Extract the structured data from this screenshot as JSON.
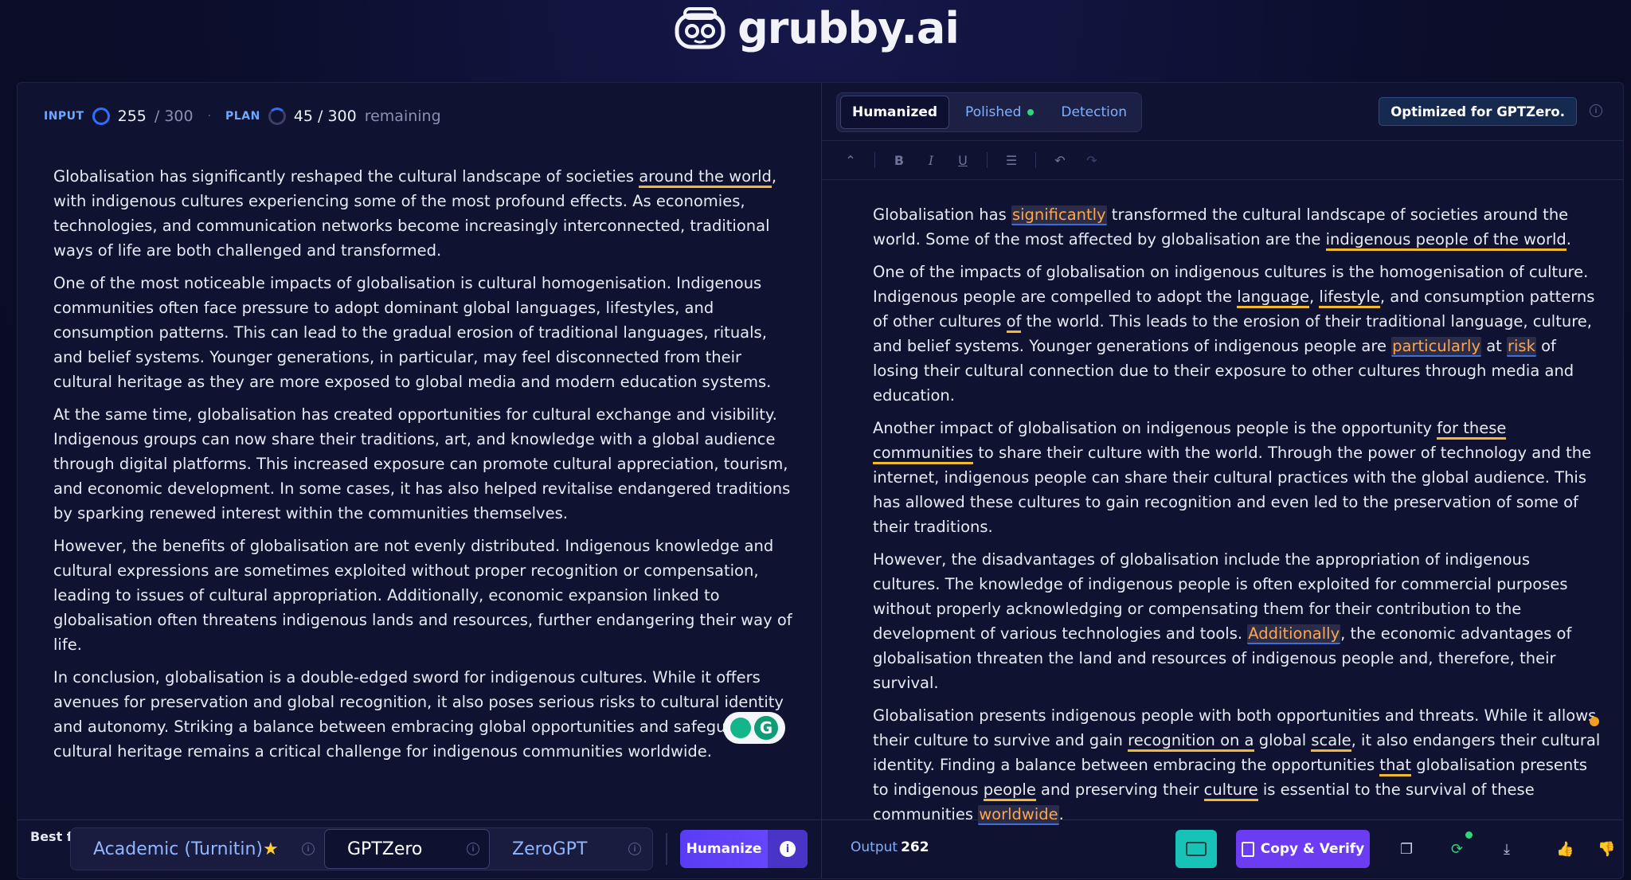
{
  "brand": {
    "name": "grubby.ai"
  },
  "input_stats": {
    "input_label": "INPUT",
    "input_count": "255",
    "input_total": "/ 300",
    "plan_label": "PLAN",
    "plan_count": "45 / 300",
    "plan_suffix": "remaining"
  },
  "input_text": {
    "p1_a": "Globalisation has significantly reshaped the cultural landscape of societies ",
    "p1_u": "around the world",
    "p1_b": ", with indigenous cultures experiencing some of the most profound effects. As economies, technologies, and communication networks become increasingly interconnected, traditional ways of life are both challenged and transformed.",
    "p2": "One of the most noticeable impacts of globalisation is cultural homogenisation. Indigenous communities often face pressure to adopt dominant global languages, lifestyles, and consumption patterns. This can lead to the gradual erosion of traditional languages, rituals, and belief systems. Younger generations, in particular, may feel disconnected from their cultural heritage as they are more exposed to global media and modern education systems.",
    "p3": "At the same time, globalisation has created opportunities for cultural exchange and visibility. Indigenous groups can now share their traditions, art, and knowledge with a global audience through digital platforms. This increased exposure can promote cultural appreciation, tourism, and economic development. In some cases, it has also helped revitalise endangered traditions by sparking renewed interest within the communities themselves.",
    "p4": "However, the benefits of globalisation are not evenly distributed. Indigenous knowledge and cultural expressions are sometimes exploited without proper recognition or compensation, leading to issues of cultural appropriation. Additionally, economic expansion linked to globalisation often threatens indigenous lands and resources, further endangering their way of life.",
    "p5": "In conclusion, globalisation is a double-edged sword for indigenous cultures. While it offers avenues for preservation and global recognition, it also poses serious risks to cultural identity and autonomy. Striking a balance between embracing global opportunities and safeguarding cultural heritage remains a critical challenge for indigenous communities worldwide."
  },
  "output_tabs": {
    "humanized": "Humanized",
    "polished": "Polished",
    "detection": "Detection",
    "optimized": "Optimized for GPTZero."
  },
  "toolbar_icons": [
    "collapse-icon",
    "bold-icon",
    "italic-icon",
    "underline-icon",
    "list-icon",
    "undo-icon",
    "redo-icon"
  ],
  "toolbar_glyphs": {
    "collapse": "⌃",
    "bold": "B",
    "italic": "I",
    "underline": "U",
    "list": "☰",
    "undo": "↶",
    "redo": "↷"
  },
  "output_text": {
    "p1_a": "Globalisation has ",
    "p1_h1": "significantly",
    "p1_b": " transformed the cultural landscape of societies around the world. Some of the most affected by globalisation are the ",
    "p1_u1": "indigenous people of the world",
    "p1_c": ".",
    "p2_a": "One of the impacts of globalisation on indigenous cultures is the homogenisation of culture. Indigenous people are compelled to adopt the ",
    "p2_u1": "language",
    "p2_b": ", ",
    "p2_u2": "lifestyle",
    "p2_c": ", and consumption patterns of other cultures ",
    "p2_u3": "of",
    "p2_d": " the world. This leads to the erosion of their traditional language, culture, and belief systems. Younger generations of indigenous people are ",
    "p2_h1": "particularly",
    "p2_e": " at ",
    "p2_h2": "risk",
    "p2_f": " of losing their cultural connection due to their exposure to other cultures through media and education.",
    "p3_a": "Another impact of globalisation on indigenous people is the opportunity ",
    "p3_u1": "for these communities",
    "p3_b": " to share their culture with the world. Through the power of technology and the internet, indigenous people can share their cultural practices with the global audience. This has allowed these cultures to gain recognition and even led to the preservation of some of their traditions.",
    "p4_a": "However, the disadvantages of globalisation include the appropriation of indigenous cultures. The knowledge of indigenous people is often exploited for commercial purposes without properly acknowledging or compensating them for their contribution to the development of various technologies and tools. ",
    "p4_h1": "Additionally",
    "p4_b": ", the economic advantages of globalisation threaten the land and resources of indigenous people and, therefore, their survival.",
    "p5_a": "Globalisation presents indigenous people with both opportunities and threats. While it allows their culture to survive and gain ",
    "p5_u1": "recognition on a",
    "p5_b": " global ",
    "p5_u2": "scale",
    "p5_c": ", it also endangers their cultural identity. Finding a balance between embracing the opportunities ",
    "p5_u3": "that",
    "p5_d": " globalisation presents to indigenous ",
    "p5_u4": "people",
    "p5_e": " and preserving their ",
    "p5_u5": "culture",
    "p5_f": " is essential to the survival of these communities ",
    "p5_h1": "worldwide",
    "p5_g": "."
  },
  "bottom_left": {
    "best_for": "Best for:",
    "mode_1": "Academic (Turnitin)",
    "mode_1_star": "★",
    "mode_2": "GPTZero",
    "mode_3": "ZeroGPT",
    "humanize": "Humanize"
  },
  "bottom_right": {
    "output_label": "Output",
    "output_count": "262",
    "copy_verify": "Copy & Verify"
  },
  "colors": {
    "background": "#0b0d2a",
    "accent": "#6b3cf2",
    "underline": "#f2b82e",
    "highlight_text": "#ffa64d",
    "teal": "#17c2b6"
  }
}
